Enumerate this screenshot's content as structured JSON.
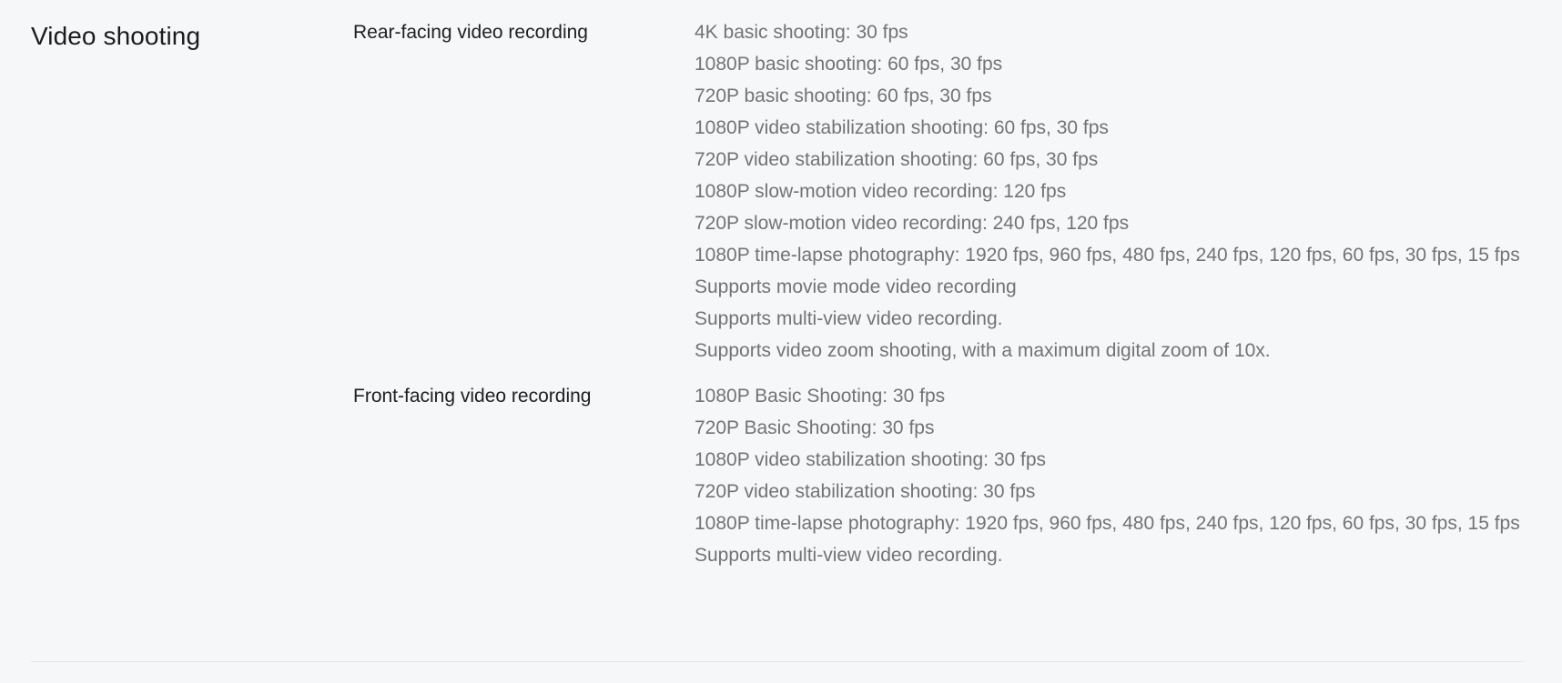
{
  "section": {
    "title": "Video shooting",
    "groups": [
      {
        "label": "Rear-facing video recording",
        "values": [
          "4K basic shooting: 30 fps",
          "1080P basic shooting: 60 fps, 30 fps",
          "720P basic shooting: 60 fps, 30 fps",
          "1080P video stabilization shooting: 60 fps, 30 fps",
          "720P video stabilization shooting: 60 fps, 30 fps",
          "1080P slow-motion video recording: 120 fps",
          "720P slow-motion video recording: 240 fps, 120 fps",
          "1080P time-lapse photography: 1920 fps, 960 fps, 480 fps, 240 fps, 120 fps, 60 fps, 30 fps, 15 fps",
          "Supports movie mode video recording",
          "Supports multi-view video recording.",
          "Supports video zoom shooting, with a maximum digital zoom of 10x."
        ]
      },
      {
        "label": "Front-facing video recording",
        "values": [
          "1080P Basic Shooting: 30 fps",
          "720P Basic Shooting: 30 fps",
          "1080P video stabilization shooting: 30 fps",
          "720P video stabilization shooting: 30 fps",
          "1080P time-lapse photography: 1920 fps, 960 fps, 480 fps, 240 fps, 120 fps, 60 fps, 30 fps, 15 fps",
          "Supports multi-view video recording."
        ]
      }
    ]
  }
}
